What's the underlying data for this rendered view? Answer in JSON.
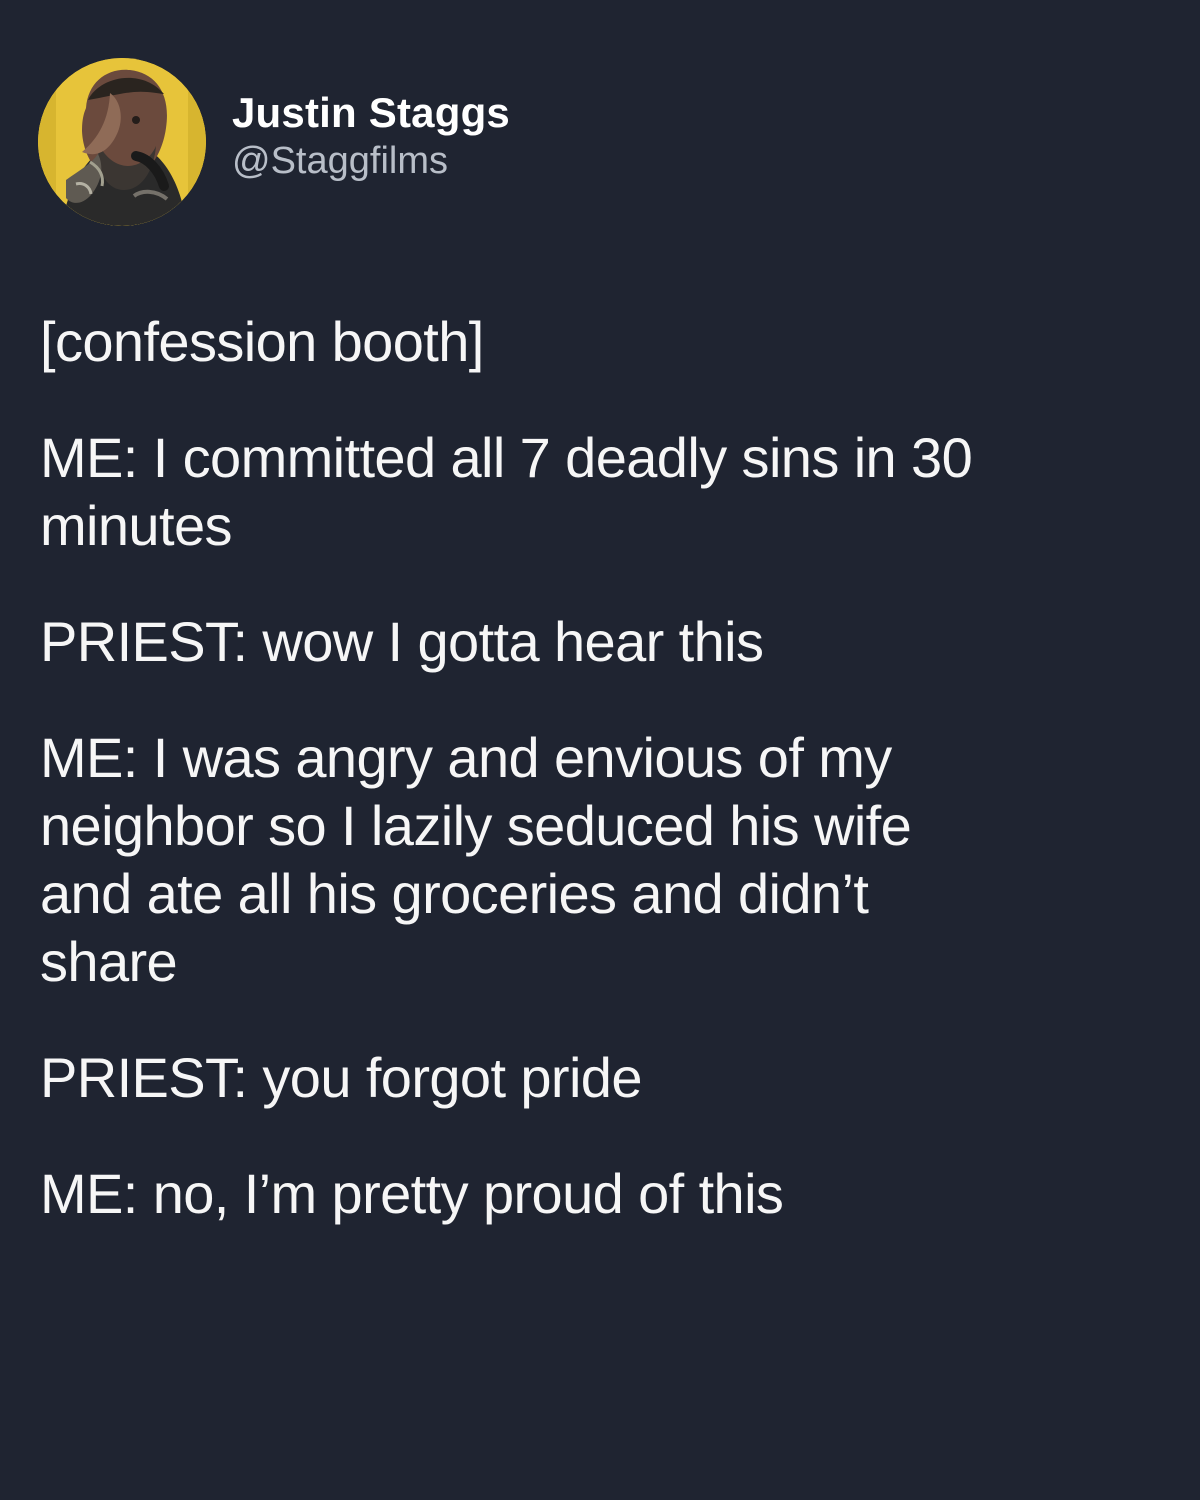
{
  "user": {
    "display_name": "Justin Staggs",
    "handle": "@Staggfilms",
    "avatar_icon": "profile-photo"
  },
  "tweet": {
    "lines": [
      "[confession booth]",
      "ME: I committed all 7 deadly sins in 30",
      "minutes",
      "PRIEST: wow I gotta hear this",
      "ME: I was angry and envious of my",
      "neighbor so I lazily seduced his wife",
      "and ate all his groceries and didn’t",
      "share",
      "PRIEST: you forgot pride",
      "ME: no, I’m pretty proud of this"
    ]
  },
  "colors": {
    "background": "#1f2431",
    "text": "#f6f6f6",
    "secondary_text": "#b8bec8",
    "avatar_background": "#e7c43a"
  }
}
